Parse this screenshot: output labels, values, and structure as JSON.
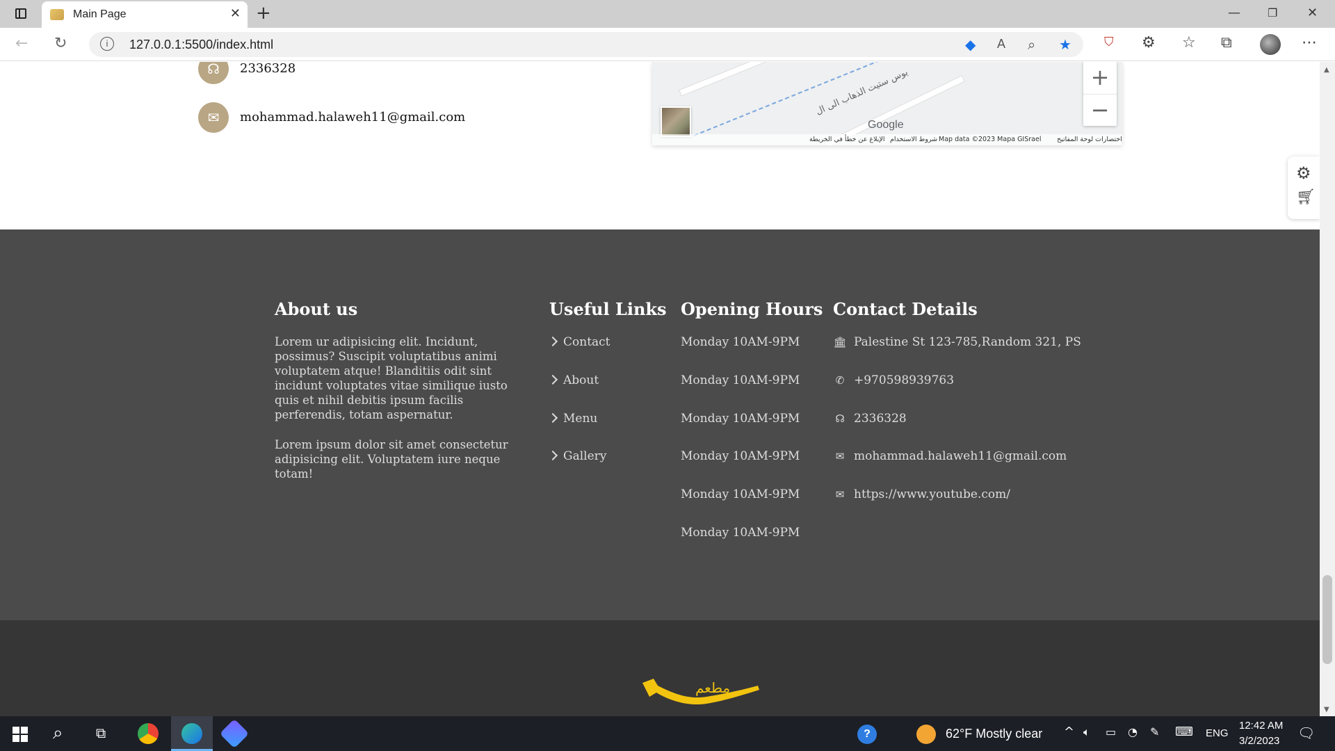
{
  "browser": {
    "tab_title": "Main Page",
    "tab_close": "✕",
    "new_tab": "+",
    "url": "127.0.0.1:5500/index.html",
    "info_glyph": "i"
  },
  "contact_section": {
    "phone": "2336328",
    "email": "mohammad.halaweh11@gmail.com"
  },
  "map": {
    "brand": "Google",
    "street_label": "يوس ستيت الذهاب الى ال",
    "attribution": {
      "shortcuts": "اختصارات لوحة المفاتيح",
      "map_data": "Map data ©2023 Mapa GISrael",
      "terms": "شروط الاستخدام",
      "report": "الإبلاغ عن خطأ في الخريطة"
    },
    "zoom_in": "+",
    "zoom_out": "−"
  },
  "footer": {
    "about": {
      "heading": "About us",
      "paragraphs": [
        "Lorem ur adipisicing elit. Incidunt, possimus? Suscipit voluptatibus animi voluptatem atque! Blanditiis odit sint incidunt voluptates vitae similique iusto quis et nihil debitis ipsum facilis perferendis, totam aspernatur.",
        "Lorem ipsum dolor sit amet consectetur adipisicing elit. Voluptatem iure neque totam!"
      ]
    },
    "useful_links": {
      "heading": "Useful Links",
      "items": [
        "Contact",
        "About",
        "Menu",
        "Gallery"
      ]
    },
    "opening_hours": {
      "heading": "Opening Hours",
      "items": [
        "Monday 10AM-9PM",
        "Monday 10AM-9PM",
        "Monday 10AM-9PM",
        "Monday 10AM-9PM",
        "Monday 10AM-9PM",
        "Monday 10AM-9PM"
      ]
    },
    "contact_details": {
      "heading": "Contact Details",
      "items": [
        {
          "icon": "bank-icon",
          "text": "Palestine St 123-785,Random 321, PS"
        },
        {
          "icon": "phone-icon",
          "text": "+970598939763"
        },
        {
          "icon": "headphones-icon",
          "text": "2336328"
        },
        {
          "icon": "envelope-icon",
          "text": "mohammad.halaweh11@gmail.com"
        },
        {
          "icon": "envelope-icon",
          "text": "https://www.youtube.com/"
        }
      ]
    },
    "logo_text": "مطعم"
  },
  "taskbar": {
    "weather": "62°F  Mostly clear",
    "language": "ENG",
    "time": "12:42 AM",
    "date": "3/2/2023"
  },
  "colors": {
    "accent_tan": "#b9a684",
    "footer_bg": "#4b4b4b",
    "bottom_bg": "#363636",
    "logo_yellow": "#f2c40f",
    "edge_blue": "#1a73e8"
  }
}
